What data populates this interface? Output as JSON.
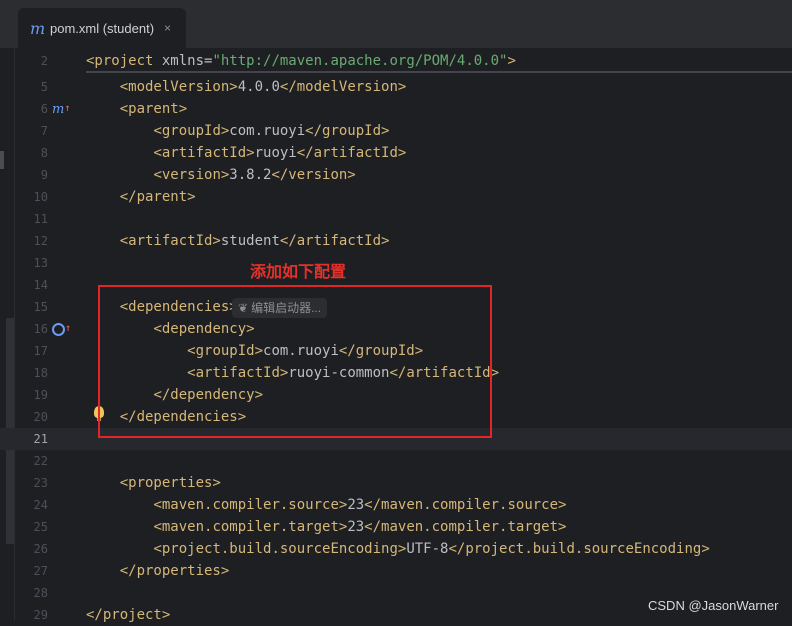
{
  "tab": {
    "icon": "maven-m-icon",
    "label": "pom.xml (student)",
    "close": "×"
  },
  "line_numbers": [
    "2",
    "5",
    "6",
    "7",
    "8",
    "9",
    "10",
    "11",
    "12",
    "13",
    "14",
    "15",
    "16",
    "17",
    "18",
    "19",
    "20",
    "21",
    "22",
    "23",
    "24",
    "25",
    "26",
    "27",
    "28",
    "29"
  ],
  "code": {
    "l2": {
      "open": "<project",
      "attr": " xmlns=",
      "value": "\"http://maven.apache.org/POM/4.0.0\"",
      "close": ">"
    },
    "l5": {
      "indent": "    ",
      "open": "<modelVersion>",
      "text": "4.0.0",
      "close": "</modelVersion>"
    },
    "l6": {
      "indent": "    ",
      "open": "<parent>"
    },
    "l7": {
      "indent": "        ",
      "open": "<groupId>",
      "text": "com.ruoyi",
      "close": "</groupId>"
    },
    "l8": {
      "indent": "        ",
      "open": "<artifactId>",
      "text": "ruoyi",
      "close": "</artifactId>"
    },
    "l9": {
      "indent": "        ",
      "open": "<version>",
      "text": "3.8.2",
      "close": "</version>"
    },
    "l10": {
      "indent": "    ",
      "open": "</parent>"
    },
    "l12": {
      "indent": "    ",
      "open": "<artifactId>",
      "text": "student",
      "close": "</artifactId>"
    },
    "l15": {
      "indent": "    ",
      "open": "<dependencies>"
    },
    "l16": {
      "indent": "        ",
      "open": "<dependency>"
    },
    "l17": {
      "indent": "            ",
      "open": "<groupId>",
      "text": "com.ruoyi",
      "close": "</groupId>"
    },
    "l18": {
      "indent": "            ",
      "open": "<artifactId>",
      "text": "ruoyi-common",
      "close": "</artifactId>"
    },
    "l19": {
      "indent": "        ",
      "open": "</dependency>"
    },
    "l20": {
      "indent": "    ",
      "open": "</dependencies>"
    },
    "l23": {
      "indent": "    ",
      "open": "<properties>"
    },
    "l24": {
      "indent": "        ",
      "open": "<maven.compiler.source>",
      "text": "23",
      "close": "</maven.compiler.source>"
    },
    "l25": {
      "indent": "        ",
      "open": "<maven.compiler.target>",
      "text": "23",
      "close": "</maven.compiler.target>"
    },
    "l26": {
      "indent": "        ",
      "open": "<project.build.sourceEncoding>",
      "text": "UTF-8",
      "close": "</project.build.sourceEncoding>"
    },
    "l27": {
      "indent": "    ",
      "open": "</properties>"
    },
    "l29": {
      "open": "</project>"
    }
  },
  "hint": {
    "icon": "spring-leaf-icon",
    "label": "编辑启动器..."
  },
  "annotation": "添加如下配置",
  "watermark": "CSDN @JasonWarner",
  "colors": {
    "background": "#1e1f22",
    "tag": "#d5b778",
    "string": "#6aab73",
    "annotation": "#e6302a"
  }
}
